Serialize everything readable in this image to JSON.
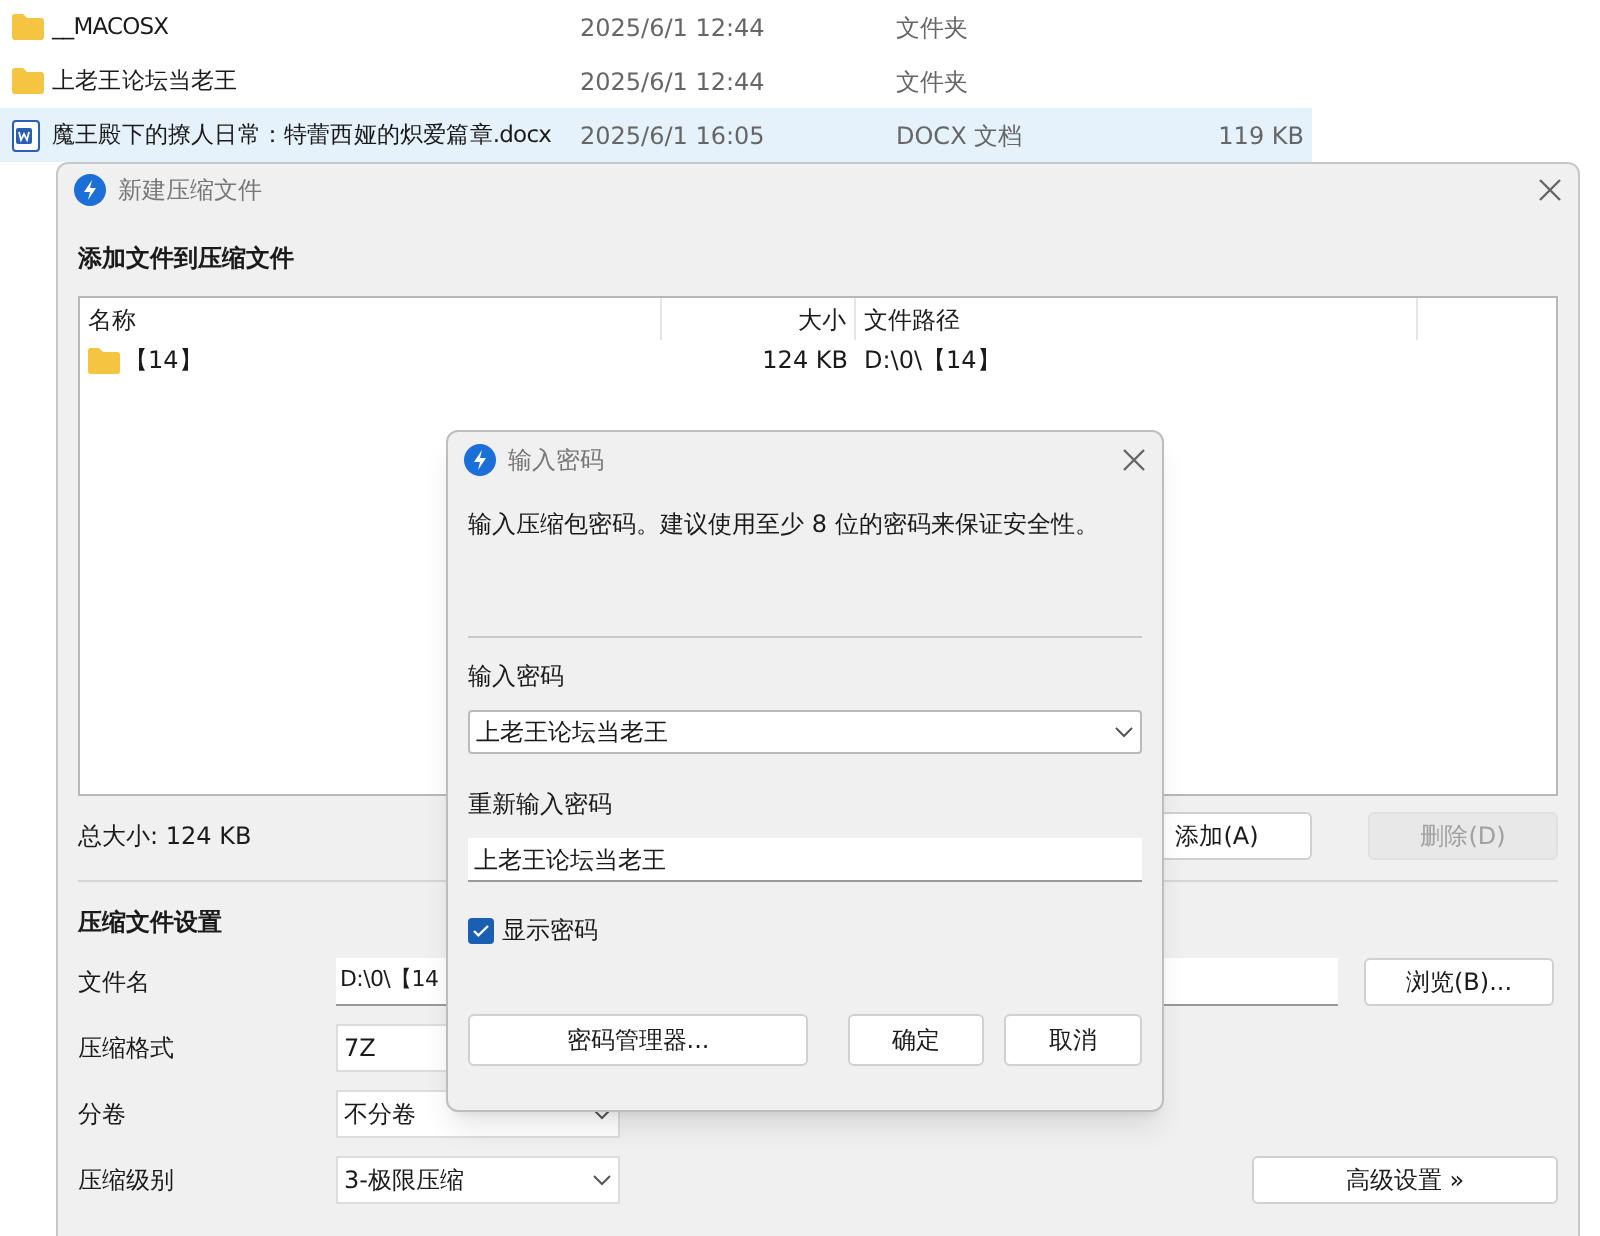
{
  "explorer": {
    "rows": [
      {
        "kind": "folder",
        "name": "__MACOSX",
        "date": "2025/6/1 12:44",
        "type": "文件夹",
        "selected": false
      },
      {
        "kind": "folder",
        "name": "上老王论坛当老王",
        "date": "2025/6/1 12:44",
        "type": "文件夹",
        "selected": false
      },
      {
        "kind": "docx",
        "name": "魔王殿下的撩人日常：特蕾西娅的炽爱篇章.docx",
        "date": "2025/6/1 16:05",
        "type": "DOCX 文档",
        "size": "119 KB",
        "selected": true
      }
    ]
  },
  "compress_dialog": {
    "title": "新建压缩文件",
    "section_title": "添加文件到压缩文件",
    "file_list": {
      "columns": [
        "名称",
        "大小",
        "文件路径"
      ],
      "rows": [
        {
          "name": "【14】",
          "size": "124 KB",
          "path": "D:\\0\\【14】"
        }
      ]
    },
    "total_size": "总大小: 124 KB",
    "list_buttons": [
      {
        "label": "添加(A)",
        "disabled": false
      },
      {
        "label": "删除(D)",
        "disabled": true
      }
    ],
    "settings_title": "压缩文件设置",
    "settings": [
      {
        "kind": "input",
        "label": "文件名",
        "value": "D:\\0\\【14"
      },
      {
        "kind": "select",
        "label": "压缩格式",
        "value": "7Z"
      },
      {
        "kind": "select",
        "label": "分卷",
        "value": "不分卷"
      },
      {
        "kind": "select",
        "label": "压缩级别",
        "value": "3-极限压缩"
      }
    ],
    "browse_button": "浏览(B)...",
    "advanced_button": "高级设置 »"
  },
  "password_dialog": {
    "title": "输入密码",
    "message": "输入压缩包密码。建议使用至少 8 位的密码来保证安全性。",
    "password_label": "输入密码",
    "password_value": "上老王论坛当老王",
    "confirm_label": "重新输入密码",
    "confirm_value": "上老王论坛当老王",
    "show_password": {
      "label": "显示密码",
      "checked": true
    },
    "manager_button": "密码管理器...",
    "ok_button": "确定",
    "cancel_button": "取消"
  }
}
